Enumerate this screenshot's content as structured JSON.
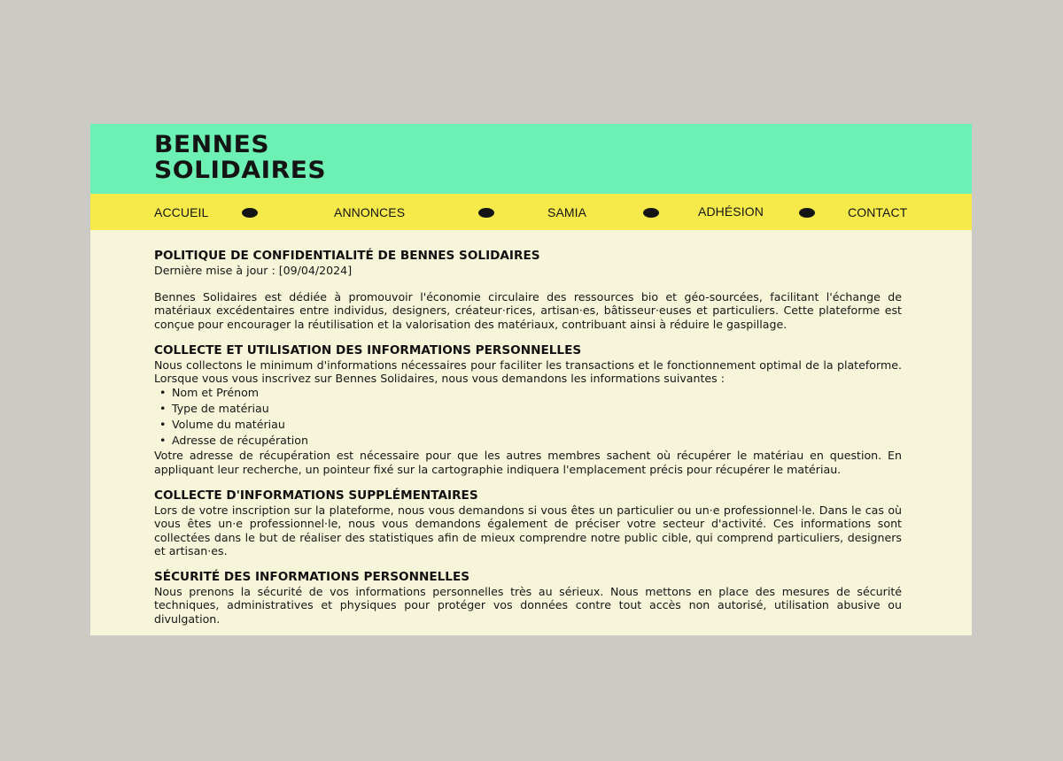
{
  "site": {
    "logo_line1": "BENNES",
    "logo_line2": "SOLIDAIRES",
    "colors": {
      "header": "#6df0b3",
      "nav": "#f6ea4a",
      "content_bg": "#f6f4d9",
      "page_bg": "#cbcac4"
    }
  },
  "nav": {
    "items": [
      {
        "label": "ACCUEIL"
      },
      {
        "label": "ANNONCES"
      },
      {
        "label": "SAMIA"
      },
      {
        "label": "ADHÉSION"
      },
      {
        "label": "CONTACT"
      }
    ],
    "separator_icon": "ellipse-dot-icon"
  },
  "policy": {
    "title": "POLITIQUE DE CONFIDENTIALITÉ DE BENNES SOLIDAIRES",
    "updated": "Dernière mise à jour : [09/04/2024]",
    "intro": "Bennes Solidaires est dédiée à promouvoir l'économie circulaire des ressources bio et géo-sourcées, facilitant l'échange de matériaux excédentaires entre individus, designers, créateur·rices, artisan·es, bâtisseur·euses et particuliers. Cette plateforme est conçue pour encourager la réutilisation et la valorisation des matériaux, contribuant ainsi à réduire le gaspillage.",
    "sections": [
      {
        "heading": "COLLECTE ET UTILISATION DES INFORMATIONS PERSONNELLES",
        "text": "Nous collectons le minimum d'informations nécessaires pour faciliter les transactions et le fonctionnement optimal de la plateforme. Lorsque vous vous inscrivez sur Bennes Solidaires, nous vous demandons les informations suivantes :",
        "list": [
          "Nom et Prénom",
          "Type de matériau",
          "Volume du matériau",
          "Adresse de récupération"
        ],
        "after": "Votre adresse de récupération est nécessaire pour que les autres membres sachent où récupérer le matériau en question. En appliquant leur recherche, un pointeur fixé sur la cartographie indiquera l'emplacement précis pour récupérer le matériau."
      },
      {
        "heading": "COLLECTE D'INFORMATIONS SUPPLÉMENTAIRES",
        "text": "Lors de votre inscription sur la plateforme, nous vous demandons si vous êtes un particulier ou un·e professionnel·le. Dans le cas où vous êtes un·e professionnel·le, nous vous demandons également de préciser votre secteur d'activité. Ces informations sont collectées dans le but de réaliser des statistiques afin de mieux comprendre notre public cible, qui comprend particuliers, designers et artisan·es."
      },
      {
        "heading": "SÉCURITÉ DES INFORMATIONS PERSONNELLES",
        "text": "Nous prenons la sécurité de vos informations personnelles très au sérieux. Nous mettons en place des mesures de sécurité techniques, administratives et physiques pour protéger vos données contre tout accès non autorisé, utilisation abusive ou divulgation."
      }
    ]
  }
}
